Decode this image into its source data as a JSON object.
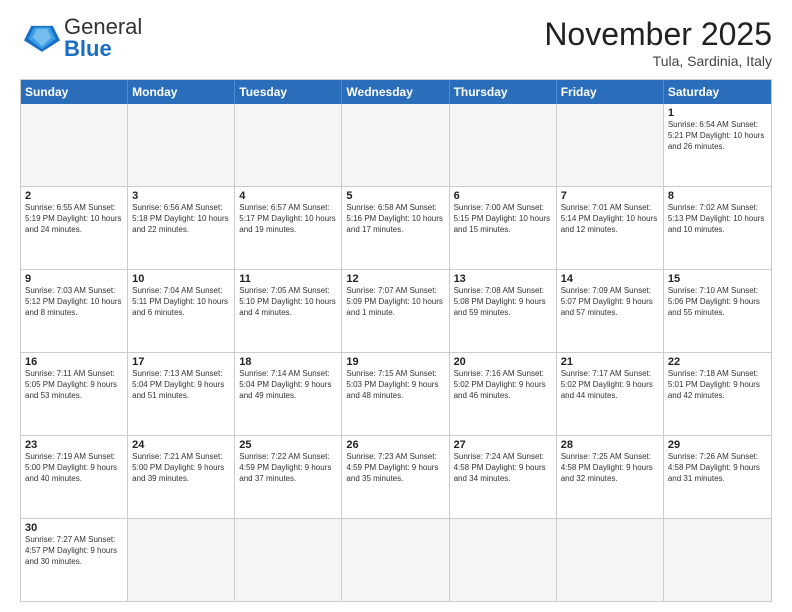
{
  "header": {
    "logo_general": "General",
    "logo_blue": "Blue",
    "month_title": "November 2025",
    "location": "Tula, Sardinia, Italy"
  },
  "days_of_week": [
    "Sunday",
    "Monday",
    "Tuesday",
    "Wednesday",
    "Thursday",
    "Friday",
    "Saturday"
  ],
  "weeks": [
    [
      {
        "day": "",
        "info": "",
        "empty": true
      },
      {
        "day": "",
        "info": "",
        "empty": true
      },
      {
        "day": "",
        "info": "",
        "empty": true
      },
      {
        "day": "",
        "info": "",
        "empty": true
      },
      {
        "day": "",
        "info": "",
        "empty": true
      },
      {
        "day": "",
        "info": "",
        "empty": true
      },
      {
        "day": "1",
        "info": "Sunrise: 6:54 AM\nSunset: 5:21 PM\nDaylight: 10 hours and 26 minutes."
      }
    ],
    [
      {
        "day": "2",
        "info": "Sunrise: 6:55 AM\nSunset: 5:19 PM\nDaylight: 10 hours and 24 minutes."
      },
      {
        "day": "3",
        "info": "Sunrise: 6:56 AM\nSunset: 5:18 PM\nDaylight: 10 hours and 22 minutes."
      },
      {
        "day": "4",
        "info": "Sunrise: 6:57 AM\nSunset: 5:17 PM\nDaylight: 10 hours and 19 minutes."
      },
      {
        "day": "5",
        "info": "Sunrise: 6:58 AM\nSunset: 5:16 PM\nDaylight: 10 hours and 17 minutes."
      },
      {
        "day": "6",
        "info": "Sunrise: 7:00 AM\nSunset: 5:15 PM\nDaylight: 10 hours and 15 minutes."
      },
      {
        "day": "7",
        "info": "Sunrise: 7:01 AM\nSunset: 5:14 PM\nDaylight: 10 hours and 12 minutes."
      },
      {
        "day": "8",
        "info": "Sunrise: 7:02 AM\nSunset: 5:13 PM\nDaylight: 10 hours and 10 minutes."
      }
    ],
    [
      {
        "day": "9",
        "info": "Sunrise: 7:03 AM\nSunset: 5:12 PM\nDaylight: 10 hours and 8 minutes."
      },
      {
        "day": "10",
        "info": "Sunrise: 7:04 AM\nSunset: 5:11 PM\nDaylight: 10 hours and 6 minutes."
      },
      {
        "day": "11",
        "info": "Sunrise: 7:05 AM\nSunset: 5:10 PM\nDaylight: 10 hours and 4 minutes."
      },
      {
        "day": "12",
        "info": "Sunrise: 7:07 AM\nSunset: 5:09 PM\nDaylight: 10 hours and 1 minute."
      },
      {
        "day": "13",
        "info": "Sunrise: 7:08 AM\nSunset: 5:08 PM\nDaylight: 9 hours and 59 minutes."
      },
      {
        "day": "14",
        "info": "Sunrise: 7:09 AM\nSunset: 5:07 PM\nDaylight: 9 hours and 57 minutes."
      },
      {
        "day": "15",
        "info": "Sunrise: 7:10 AM\nSunset: 5:06 PM\nDaylight: 9 hours and 55 minutes."
      }
    ],
    [
      {
        "day": "16",
        "info": "Sunrise: 7:11 AM\nSunset: 5:05 PM\nDaylight: 9 hours and 53 minutes."
      },
      {
        "day": "17",
        "info": "Sunrise: 7:13 AM\nSunset: 5:04 PM\nDaylight: 9 hours and 51 minutes."
      },
      {
        "day": "18",
        "info": "Sunrise: 7:14 AM\nSunset: 5:04 PM\nDaylight: 9 hours and 49 minutes."
      },
      {
        "day": "19",
        "info": "Sunrise: 7:15 AM\nSunset: 5:03 PM\nDaylight: 9 hours and 48 minutes."
      },
      {
        "day": "20",
        "info": "Sunrise: 7:16 AM\nSunset: 5:02 PM\nDaylight: 9 hours and 46 minutes."
      },
      {
        "day": "21",
        "info": "Sunrise: 7:17 AM\nSunset: 5:02 PM\nDaylight: 9 hours and 44 minutes."
      },
      {
        "day": "22",
        "info": "Sunrise: 7:18 AM\nSunset: 5:01 PM\nDaylight: 9 hours and 42 minutes."
      }
    ],
    [
      {
        "day": "23",
        "info": "Sunrise: 7:19 AM\nSunset: 5:00 PM\nDaylight: 9 hours and 40 minutes."
      },
      {
        "day": "24",
        "info": "Sunrise: 7:21 AM\nSunset: 5:00 PM\nDaylight: 9 hours and 39 minutes."
      },
      {
        "day": "25",
        "info": "Sunrise: 7:22 AM\nSunset: 4:59 PM\nDaylight: 9 hours and 37 minutes."
      },
      {
        "day": "26",
        "info": "Sunrise: 7:23 AM\nSunset: 4:59 PM\nDaylight: 9 hours and 35 minutes."
      },
      {
        "day": "27",
        "info": "Sunrise: 7:24 AM\nSunset: 4:58 PM\nDaylight: 9 hours and 34 minutes."
      },
      {
        "day": "28",
        "info": "Sunrise: 7:25 AM\nSunset: 4:58 PM\nDaylight: 9 hours and 32 minutes."
      },
      {
        "day": "29",
        "info": "Sunrise: 7:26 AM\nSunset: 4:58 PM\nDaylight: 9 hours and 31 minutes."
      }
    ],
    [
      {
        "day": "30",
        "info": "Sunrise: 7:27 AM\nSunset: 4:57 PM\nDaylight: 9 hours and 30 minutes."
      },
      {
        "day": "",
        "info": "",
        "empty": true
      },
      {
        "day": "",
        "info": "",
        "empty": true
      },
      {
        "day": "",
        "info": "",
        "empty": true
      },
      {
        "day": "",
        "info": "",
        "empty": true
      },
      {
        "day": "",
        "info": "",
        "empty": true
      },
      {
        "day": "",
        "info": "",
        "empty": true
      }
    ]
  ]
}
